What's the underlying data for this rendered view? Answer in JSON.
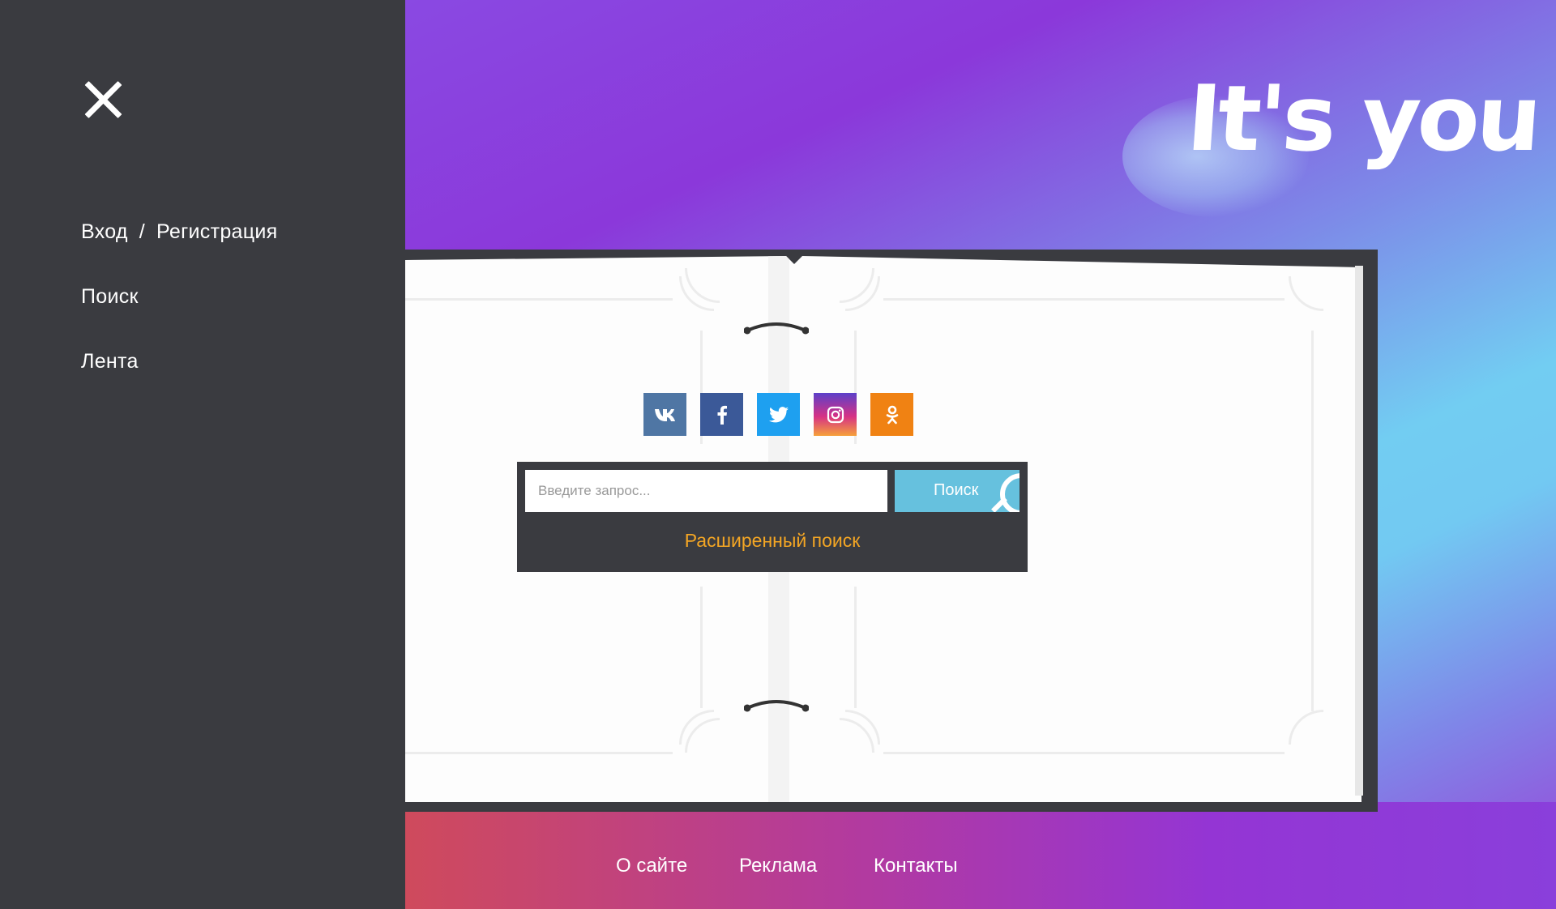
{
  "sidebar": {
    "close_icon": "close-icon",
    "login_label": "Вход",
    "separator": "/",
    "register_label": "Регистрация",
    "search_label": "Поиск",
    "feed_label": "Лента"
  },
  "logo": {
    "text": "It's you"
  },
  "social": [
    {
      "name": "vk",
      "glyph": "vk"
    },
    {
      "name": "facebook",
      "glyph": "f"
    },
    {
      "name": "twitter",
      "glyph": "twitter-bird"
    },
    {
      "name": "instagram",
      "glyph": "camera"
    },
    {
      "name": "odnoklassniki",
      "glyph": "ok"
    }
  ],
  "search": {
    "placeholder": "Введите запрос...",
    "button_label": "Поиск",
    "advanced_label": "Расширенный поиск"
  },
  "footer": {
    "about": "О сайте",
    "ads": "Реклама",
    "contacts": "Контакты"
  },
  "colors": {
    "sidebar_bg": "#3a3b40",
    "accent_orange": "#f4a624",
    "search_button": "#66c1de",
    "gradient_purple": "#8b38da",
    "gradient_blue": "#72cdf2"
  }
}
